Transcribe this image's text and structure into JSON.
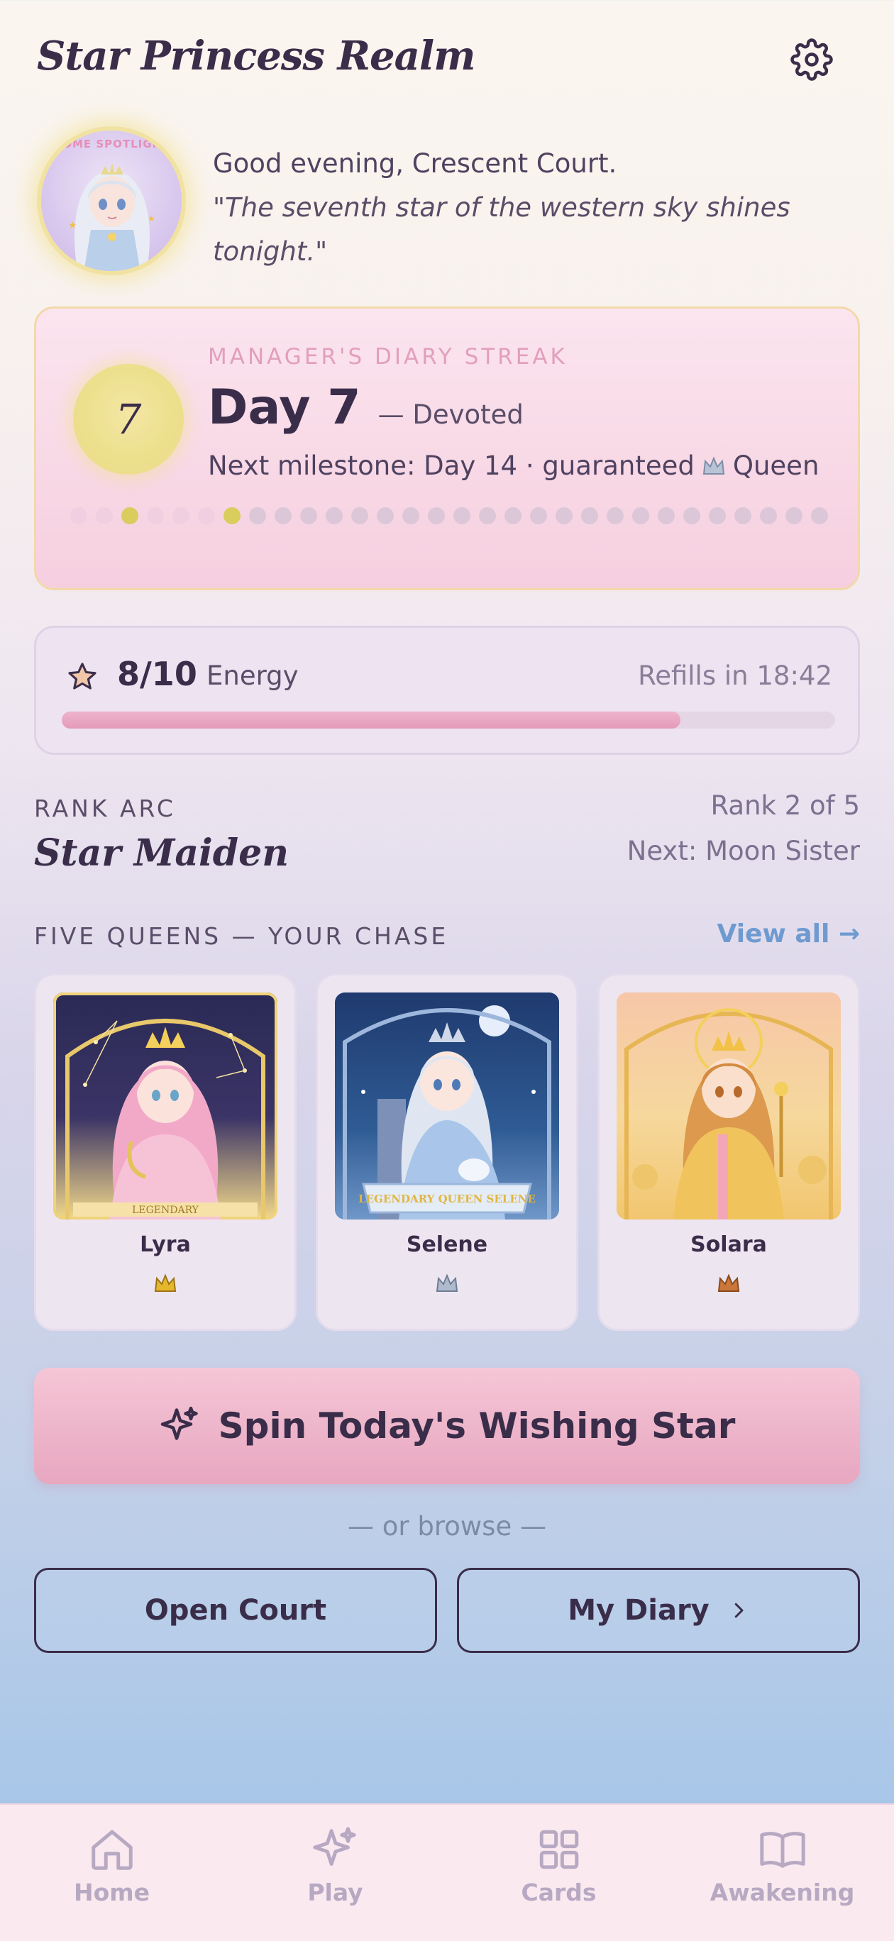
{
  "app": {
    "title": "Star Princess Realm"
  },
  "spotlight": {
    "avatar_label": "HOME SPOTLIGHT",
    "greeting": "Good evening, Crescent Court.",
    "quote": "\"The seventh star of the western sky shines tonight.\""
  },
  "streak": {
    "kicker": "MANAGER'S DIARY STREAK",
    "badge_value": "7",
    "day_label": "Day 7",
    "tier": "— Devoted",
    "next_milestone": "Next milestone: Day 14 · guaranteed",
    "next_reward": "Queen",
    "current_day": 7,
    "total_days": 30,
    "milestone_days": [
      3,
      7
    ]
  },
  "energy": {
    "value": "8/10",
    "label": "Energy",
    "refill": "Refills in 18:42",
    "fraction": 0.8
  },
  "rank": {
    "kicker": "RANK ARC",
    "name": "Star Maiden",
    "position": "Rank 2 of 5",
    "next": "Next: Moon Sister"
  },
  "queens": {
    "title": "FIVE QUEENS — YOUR CHASE",
    "view_all": "View all →",
    "items": [
      {
        "name": "Lyra",
        "art_label": "LEGENDARY",
        "crown": "gold"
      },
      {
        "name": "Selene",
        "art_label": "LEGENDARY QUEEN SELENE",
        "crown": "silver"
      },
      {
        "name": "Solara",
        "art_label": "",
        "crown": "bronze"
      }
    ]
  },
  "actions": {
    "spin": "Spin Today's Wishing Star",
    "browse": "— or browse —",
    "open_court": "Open Court",
    "my_diary": "My Diary"
  },
  "nav": {
    "items": [
      {
        "label": "Home",
        "icon": "home-icon"
      },
      {
        "label": "Play",
        "icon": "sparkle-icon"
      },
      {
        "label": "Cards",
        "icon": "grid-icon"
      },
      {
        "label": "Awakening",
        "icon": "book-icon"
      }
    ]
  },
  "colors": {
    "ink": "#3a2d4a",
    "accent_pink": "#e7a7c0",
    "link_blue": "#6f9ad0",
    "gold": "#d9cd5e"
  }
}
